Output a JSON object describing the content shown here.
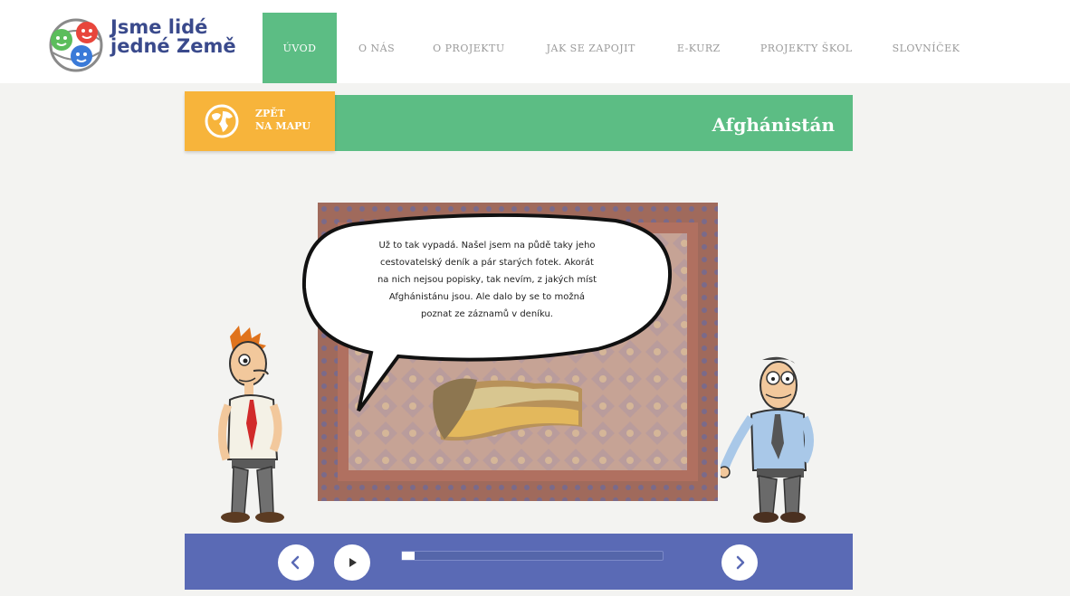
{
  "logo": {
    "line1": "Jsme lidé",
    "line2": "jedné Země"
  },
  "nav": [
    {
      "label": "ÚVOD",
      "active": true
    },
    {
      "label": "O NÁS",
      "active": false
    },
    {
      "label": "O PROJEKTU",
      "active": false
    },
    {
      "label": "JAK SE ZAPOJIT",
      "active": false
    },
    {
      "label": "E-KURZ",
      "active": false
    },
    {
      "label": "PROJEKTY ŠKOL",
      "active": false
    },
    {
      "label": "SLOVNÍČEK",
      "active": false
    }
  ],
  "back": {
    "line1": "ZPĚT",
    "line2": "NA MAPU",
    "icon": "globe-icon"
  },
  "country": "Afghánistán",
  "speech": {
    "lines": [
      "Už to tak vypadá. Našel jsem na půdě taky jeho",
      "cestovatelský deník a pár starých fotek. Akorát",
      "na nich nejsou popisky, tak nevím, z jakých míst",
      "Afghánistánu jsou. Ale dalo by se to možná",
      "poznat ze záznamů v deníku."
    ]
  },
  "player": {
    "prev_icon": "chevron-left-icon",
    "play_icon": "play-icon",
    "next_icon": "chevron-right-icon",
    "progress": 0.05
  },
  "colors": {
    "green": "#5cbd84",
    "orange": "#f7b43b",
    "blue": "#5a6ab5",
    "nav_text": "#9a9a9a"
  }
}
